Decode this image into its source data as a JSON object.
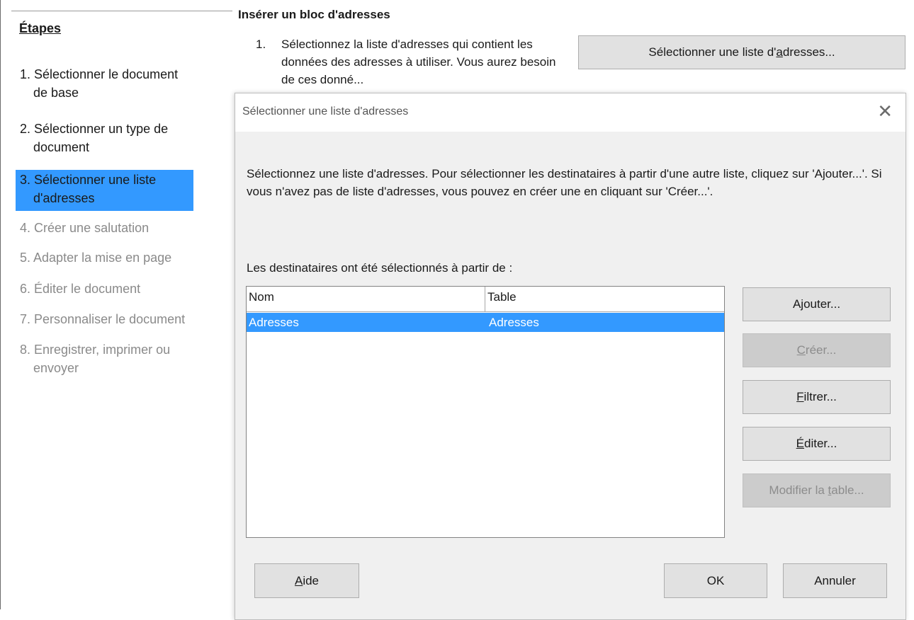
{
  "steps": {
    "title": "Étapes",
    "items": [
      {
        "num": "1.",
        "line1": "Sélectionner le document",
        "line2": "de base"
      },
      {
        "num": "2.",
        "line1": "Sélectionner un type de",
        "line2": "document"
      },
      {
        "num": "3.",
        "line1": "Sélectionner une liste",
        "line2": "d'adresses"
      },
      {
        "num": "4.",
        "line1": "Créer une salutation"
      },
      {
        "num": "5.",
        "line1": "Adapter la mise en page"
      },
      {
        "num": "6.",
        "line1": "Éditer le document"
      },
      {
        "num": "7.",
        "line1": "Personnaliser le document"
      },
      {
        "num": "8.",
        "line1": "Enregistrer, imprimer ou",
        "line2": "envoyer"
      }
    ]
  },
  "page": {
    "section_title": "Insérer un bloc d'adresses",
    "instruction_num": "1.",
    "instruction_text": "Sélectionnez la liste d'adresses qui contient les données des adresses à utiliser. Vous aurez besoin de ces donné...",
    "select_list_button_pre": "Sélectionner une liste d'",
    "select_list_button_key": "a",
    "select_list_button_post": "dresses..."
  },
  "dialog": {
    "title": "Sélectionner une liste d'adresses",
    "close_glyph": "✕",
    "description": "Sélectionnez une liste d'adresses. Pour sélectionner les destinataires à partir d'une autre liste, cliquez sur 'Ajouter...'. Si vous n'avez pas de liste d'adresses, vous pouvez en créer une en cliquant sur 'Créer...'.",
    "recipients_label": "Les destinataires ont été sélectionnés à partir de :",
    "columns": [
      "Nom",
      "Table"
    ],
    "rows": [
      {
        "nom": "Adresses",
        "table": "Adresses"
      }
    ],
    "buttons": {
      "add": {
        "pre": "A",
        "key": "j",
        "post": "outer..."
      },
      "create": {
        "pre": "",
        "key": "C",
        "post": "réer..."
      },
      "filter": {
        "pre": "",
        "key": "F",
        "post": "iltrer..."
      },
      "edit": {
        "pre": "",
        "key": "É",
        "post": "diter..."
      },
      "modify_table": {
        "pre": "Modifier la ",
        "key": "t",
        "post": "able..."
      },
      "help": {
        "pre": "",
        "key": "A",
        "post": "ide"
      },
      "ok": "OK",
      "cancel": "Annuler"
    }
  },
  "colors": {
    "selection": "#3399ff",
    "button_bg": "#e1e1e1",
    "disabled_button_bg": "#cccccc",
    "dialog_bg": "#f0f0f0"
  }
}
